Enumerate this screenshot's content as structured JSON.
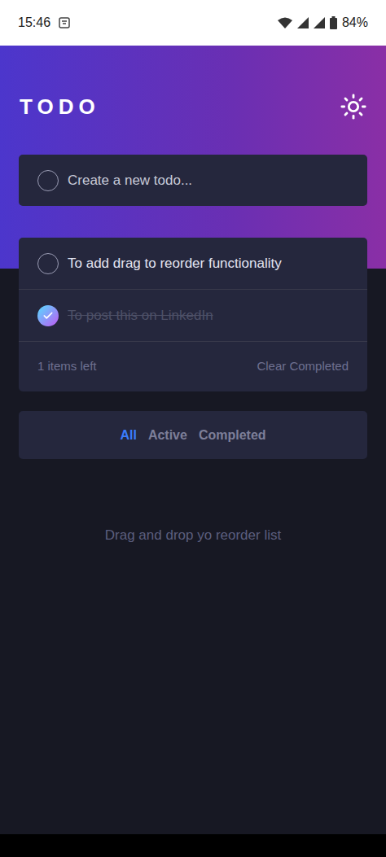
{
  "status_bar": {
    "time": "15:46",
    "battery": "84%"
  },
  "app": {
    "title": "TODO"
  },
  "new_todo": {
    "placeholder": "Create a new todo..."
  },
  "todos": [
    {
      "text": "To add drag to reorder functionality",
      "completed": false
    },
    {
      "text": "To post this on LinkedIn",
      "completed": true
    }
  ],
  "footer": {
    "items_left": "1 items left",
    "clear": "Clear Completed"
  },
  "filters": [
    {
      "label": "All",
      "selected": true
    },
    {
      "label": "Active",
      "selected": false
    },
    {
      "label": "Completed",
      "selected": false
    }
  ],
  "hint": "Drag and drop yo reorder list"
}
